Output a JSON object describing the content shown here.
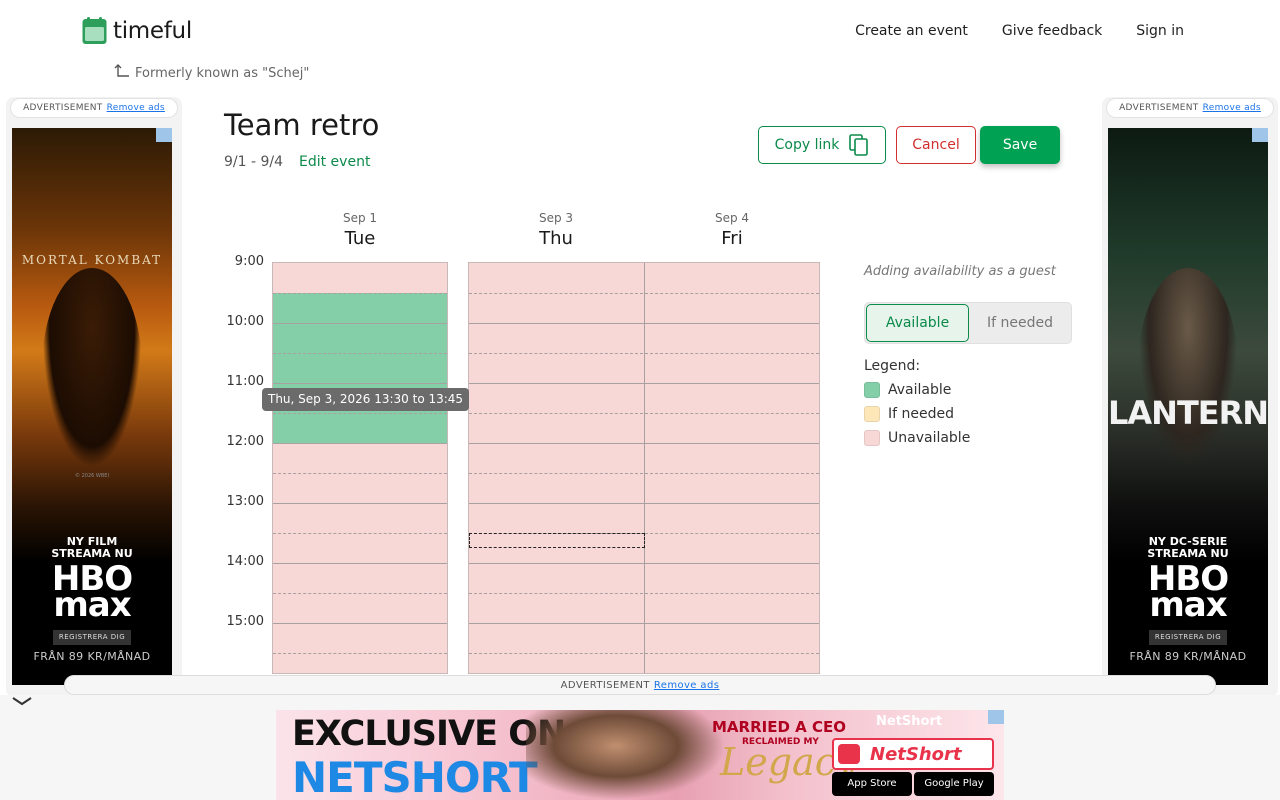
{
  "app": {
    "brand": "timeful",
    "formerly": "Formerly known as \"Schej\"",
    "nav": [
      "Create an event",
      "Give feedback",
      "Sign in"
    ]
  },
  "colors": {
    "accent": "#0b8a4a",
    "save_bg": "#00a152",
    "cancel": "#d32f2f",
    "available": "#84cfa8",
    "if_needed": "#fde6b8",
    "unavailable": "#f8d7d7"
  },
  "event": {
    "title": "Team retro",
    "date_range": "9/1 - 9/4",
    "edit_label": "Edit event"
  },
  "actions": {
    "copy_link": "Copy link",
    "copy_icon": "copy-icon",
    "cancel": "Cancel",
    "save": "Save"
  },
  "calendar": {
    "days": [
      {
        "date": "Sep 1",
        "name": "Tue"
      },
      {
        "date": "Sep 3",
        "name": "Thu"
      },
      {
        "date": "Sep 4",
        "name": "Fri"
      }
    ],
    "times": [
      "9:00",
      "10:00",
      "11:00",
      "12:00",
      "13:00",
      "14:00",
      "15:00"
    ],
    "tooltip": "Thu, Sep 3, 2026 13:30 to 13:45"
  },
  "panel": {
    "guest_note": "Adding availability as a guest",
    "toggle_available": "Available",
    "toggle_if_needed": "If needed",
    "legend_title": "Legend:",
    "legend": [
      "Available",
      "If needed",
      "Unavailable"
    ]
  },
  "ads": {
    "label": "ADVERTISEMENT",
    "remove": "Remove ads",
    "left": {
      "title": "MORTAL KOMBAT",
      "copyright": "© 2026 WBEI",
      "cta": "NY FILM\nSTREAMA NU",
      "logo": "HBO\nmax",
      "register": "REGISTRERA DIG",
      "price": "FRÅN 89 KR/MÅNAD"
    },
    "right": {
      "title": "LANTERNS",
      "cta": "NY DC-SERIE\nSTREAMA NU",
      "logo": "HBO\nmax",
      "register": "REGISTRERA DIG",
      "price": "FRÅN 89 KR/MÅNAD"
    },
    "bottom": {
      "line1": "EXCLUSIVE ON",
      "line2": "NETSHORT",
      "line3": "MARRIED A CEO",
      "line4": "RECLAIMED MY",
      "line5": "Legacy",
      "brand": "NetShort",
      "app_store": "App Store",
      "google_play": "Google Play"
    }
  }
}
